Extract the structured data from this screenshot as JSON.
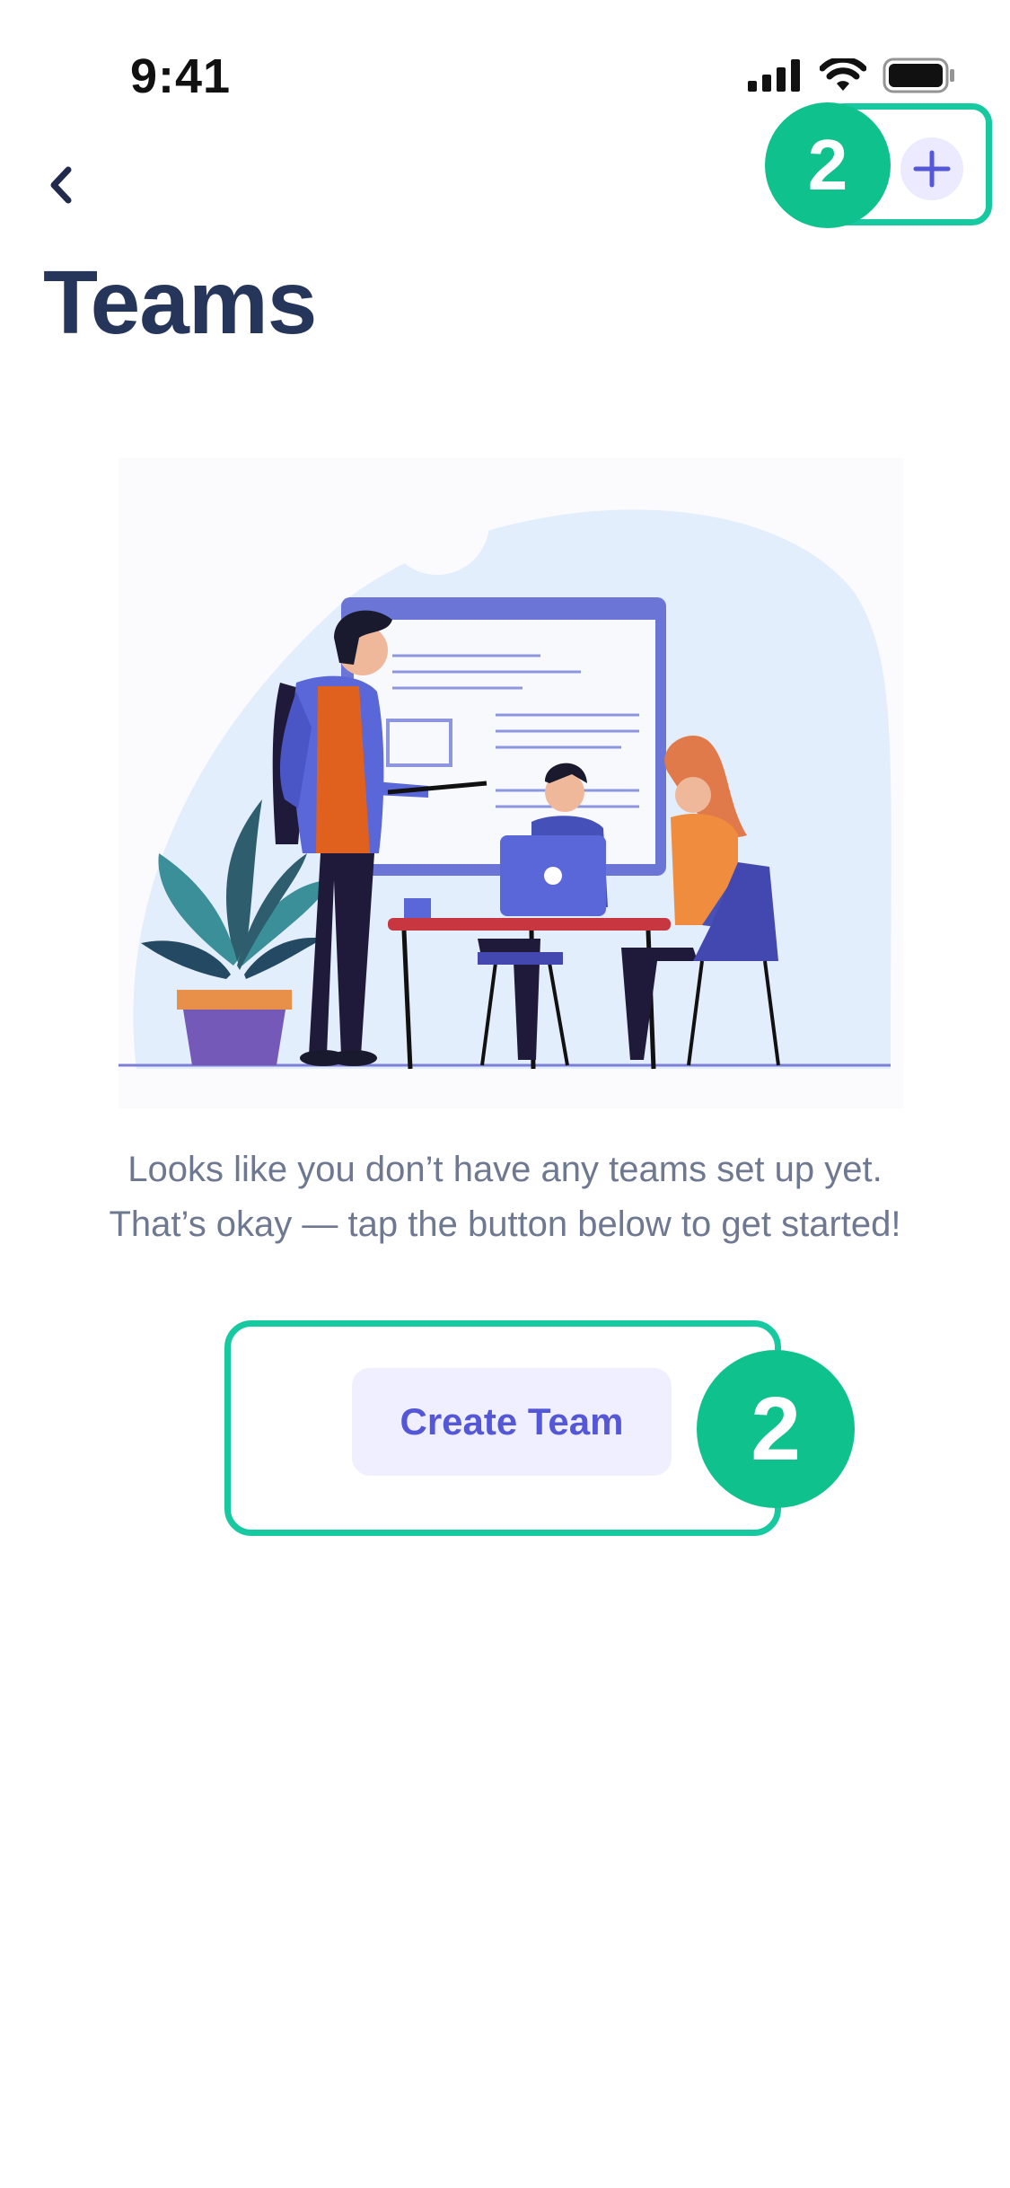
{
  "status_bar": {
    "time": "9:41",
    "icons": [
      "signal-icon",
      "wifi-icon",
      "battery-icon"
    ]
  },
  "header": {
    "back_icon": "chevron-left-icon",
    "title": "Teams",
    "add_icon": "plus-icon"
  },
  "annotations": {
    "top_step": "2",
    "bottom_step": "2"
  },
  "empty_state": {
    "illustration": "team-meeting-illustration",
    "message": "Looks like you don’t have any teams set up yet. That’s okay — tap the button below to get started!",
    "button_label": "Create Team"
  },
  "colors": {
    "title": "#26355a",
    "accent": "#5457d8",
    "annotation": "#0ec18d",
    "body_text": "#6e7891"
  }
}
